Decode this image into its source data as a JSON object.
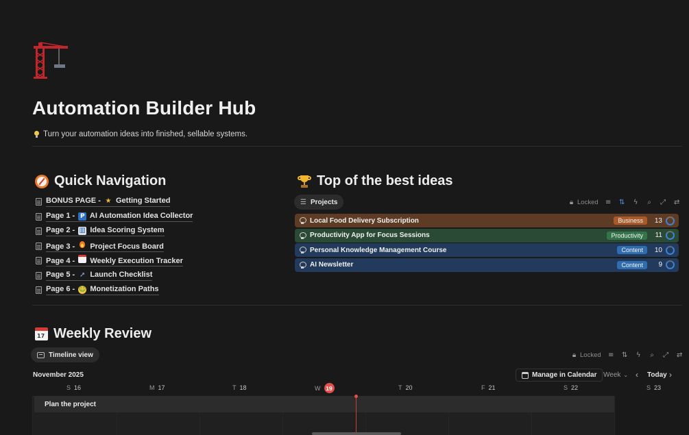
{
  "page": {
    "icon": "construction-crane-icon",
    "title": "Automation Builder Hub",
    "tagline_icon": "lightbulb-icon",
    "tagline": "Turn your automation ideas into finished, sellable systems."
  },
  "quick_nav": {
    "icon": "compass-icon",
    "title": "Quick Navigation",
    "items": [
      {
        "prefix": "BONUS PAGE -",
        "emoji": "★",
        "emoji_name": "star-icon",
        "label": "Getting Started"
      },
      {
        "prefix": "Page 1 -",
        "emoji": "P",
        "emoji_name": "parking-icon",
        "label": "AI Automation Idea Collector"
      },
      {
        "prefix": "Page 2 -",
        "emoji": "▥",
        "emoji_name": "bar-chart-icon",
        "label": "Idea Scoring System"
      },
      {
        "prefix": "Page 3 -",
        "emoji": "🔥",
        "emoji_name": "fire-icon",
        "label": "Project Focus Board"
      },
      {
        "prefix": "Page 4 -",
        "emoji": "▤",
        "emoji_name": "calendar-icon",
        "label": "Weekly Execution Tracker"
      },
      {
        "prefix": "Page 5 -",
        "emoji": "➚",
        "emoji_name": "rocket-icon",
        "label": "Launch Checklist"
      },
      {
        "prefix": "Page 6 -",
        "emoji": "☺",
        "emoji_name": "money-face-icon",
        "label": "Monetization Paths"
      }
    ]
  },
  "top_ideas": {
    "icon": "trophy-icon",
    "title": "Top of the best ideas",
    "view_label": "Projects",
    "locked_label": "Locked",
    "rows": [
      {
        "name": "Local Food Delivery Subscription",
        "tag": "Business",
        "score": "13",
        "row_color": "#5e3b24",
        "tag_color": "#a85a2b"
      },
      {
        "name": "Productivity App for Focus Sessions",
        "tag": "Productivity",
        "score": "11",
        "row_color": "#2b4a35",
        "tag_color": "#35744a"
      },
      {
        "name": "Personal Knowledge Management Course",
        "tag": "Content",
        "score": "10",
        "row_color": "#223a5c",
        "tag_color": "#2f6cb0"
      },
      {
        "name": "AI Newsletter",
        "tag": "Content",
        "score": "9",
        "row_color": "#223a5c",
        "tag_color": "#2f6cb0"
      }
    ]
  },
  "weekly_review": {
    "icon": "calendar-icon",
    "title": "Weekly Review",
    "view_label": "Timeline view",
    "locked_label": "Locked",
    "month": "November 2025",
    "manage_label": "Manage in Calendar",
    "range_label": "Week",
    "today_label": "Today",
    "days": [
      {
        "letter": "S",
        "num": "16"
      },
      {
        "letter": "M",
        "num": "17"
      },
      {
        "letter": "T",
        "num": "18"
      },
      {
        "letter": "W",
        "num": "19",
        "today": true
      },
      {
        "letter": "T",
        "num": "20"
      },
      {
        "letter": "F",
        "num": "21"
      },
      {
        "letter": "S",
        "num": "22"
      },
      {
        "letter": "S",
        "num": "23"
      }
    ],
    "task": "Plan the project"
  }
}
